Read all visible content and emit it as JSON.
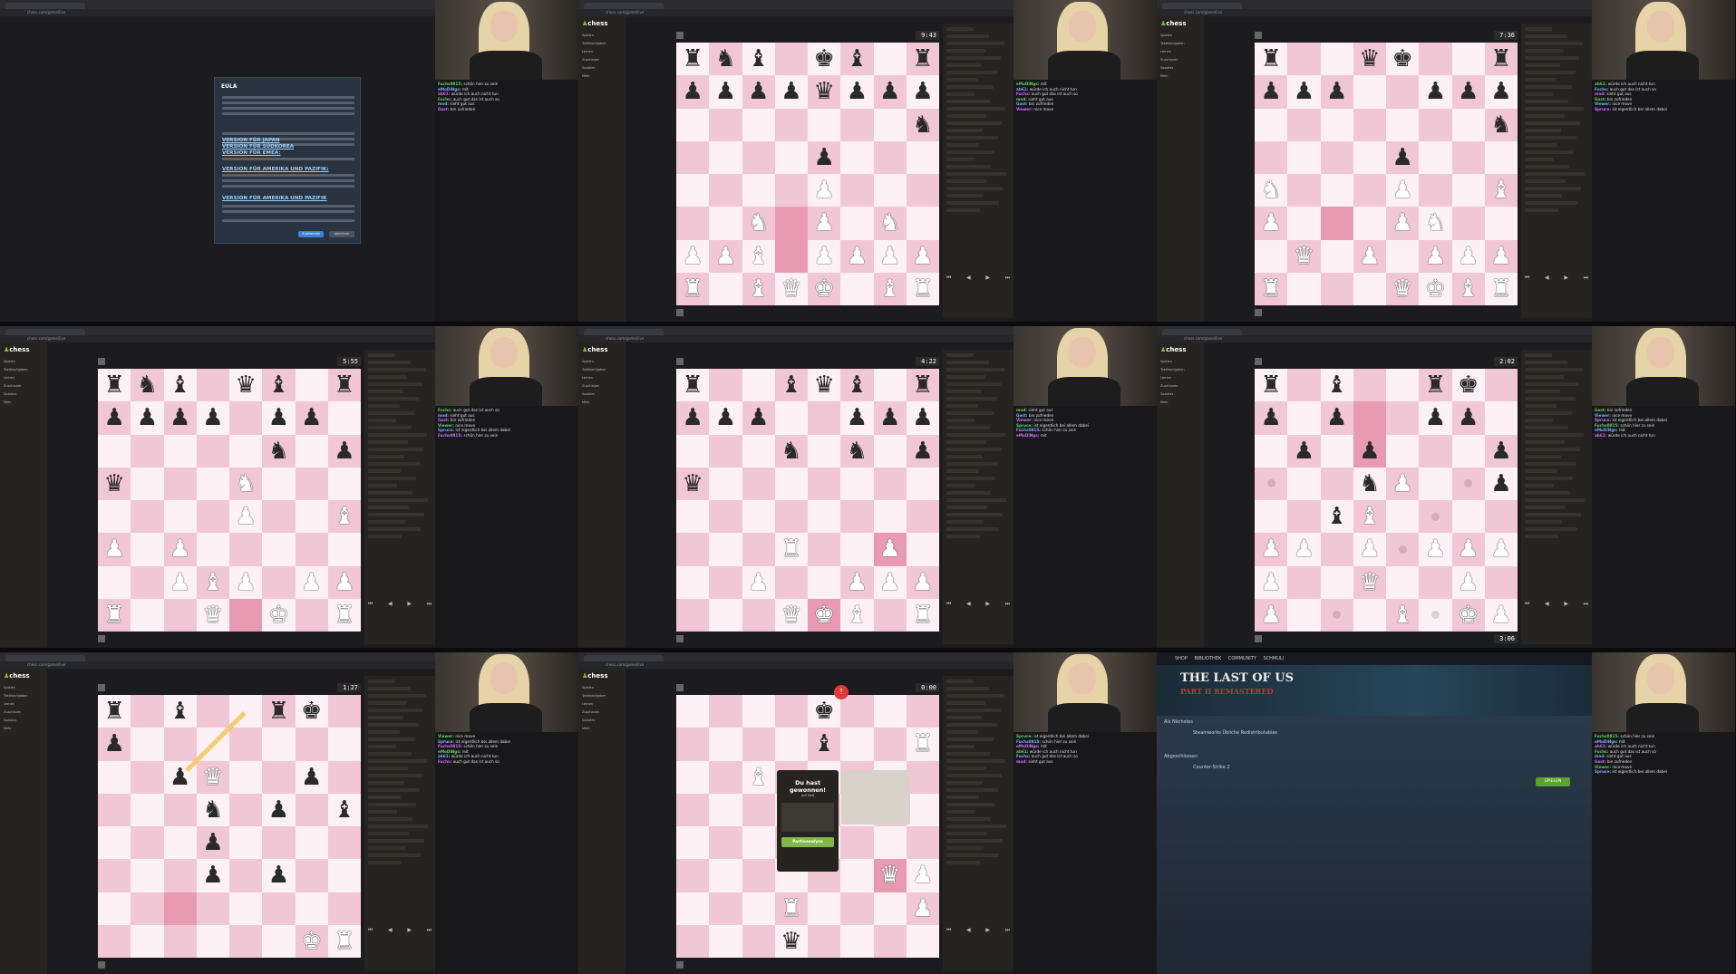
{
  "tiles": [
    {
      "kind": "eula",
      "eula": {
        "title": "EULA",
        "links": [
          "VERSION FÜR JAPAN",
          "VERSION FÜR SÜDKOREA",
          "VERSION FÜR EMEA:",
          "VERSION FÜR AMERIKA UND PAZIFIK:",
          "VERSION FÜR AMERIKA UND PAZIFIK"
        ],
        "accept": "Zustimmen",
        "decline": "Ablehnen"
      }
    },
    {
      "kind": "chess",
      "clock_top": "9:43",
      "clock_bottom": "",
      "board": [
        "rnb.kb.r",
        "ppppqppp",
        ".......n",
        "....p...",
        "....P...",
        "..N.P.N.",
        "PPB.PPPP",
        "R.BQK.BR"
      ],
      "hl": [
        [
          5,
          3
        ],
        [
          6,
          3
        ]
      ]
    },
    {
      "kind": "chess",
      "clock_top": "7:36",
      "clock_bottom": "",
      "board": [
        "r..qk..r",
        "ppp..ppp",
        ".......n",
        "....p...",
        "N...P..B",
        "P...PN..",
        ".Q.P.PPP",
        "R...QKBR"
      ],
      "hl": [
        [
          5,
          2
        ]
      ]
    },
    {
      "kind": "chess",
      "clock_top": "5:55",
      "clock_bottom": "",
      "board": [
        "rnb.qb.r",
        "pppp.pp.",
        ".....n.p",
        "q...N...",
        "....P..B",
        "P.P.....",
        "..PBP.PP",
        "R..Q.K.R"
      ],
      "hl": [
        [
          7,
          4
        ]
      ]
    },
    {
      "kind": "chess",
      "clock_top": "4:22",
      "clock_bottom": "",
      "board": [
        "r..bqb.r",
        "ppp..ppp",
        "...n.n.p",
        "q.......",
        "........",
        "...R..P.",
        "..P..PPP",
        "...QKB.R"
      ],
      "hl": [
        [
          5,
          6
        ],
        [
          7,
          4
        ]
      ]
    },
    {
      "kind": "chess",
      "clock_top": "2:02",
      "clock_bottom": "3:06",
      "board": [
        "r.b..rk.",
        "p.p..pp.",
        ".p.p...p",
        "...nP..p",
        "..bB....",
        "PP.P.PPP",
        "P..Q..P.",
        "P...B.KP"
      ],
      "hl": [
        [
          1,
          3
        ],
        [
          2,
          3
        ]
      ]
    },
    {
      "kind": "chess",
      "clock_top": "1:27",
      "clock_bottom": "",
      "board": [
        "r.b..rk.",
        "p.......",
        "..pQ..p.",
        "...n.p.b",
        "...p....",
        "...p.p..",
        "........",
        "......KR"
      ],
      "hl": [
        [
          6,
          2
        ]
      ]
    },
    {
      "kind": "chess",
      "clock_top": "0:00",
      "clock_bottom": "",
      "board": [
        "....k...",
        "....b..R",
        "..B.....",
        "........",
        "........",
        "......QP",
        "...R...P",
        "...q...."
      ],
      "hl": [
        [
          5,
          6
        ]
      ],
      "win": {
        "title": "Du hast gewonnen!",
        "sub": "auf Zeit",
        "btn": "Partieanalyse"
      }
    },
    {
      "kind": "steam",
      "nav": "SHOP BIBLIOTHEK COMMUNITY SCHMULI",
      "game_title": "THE LAST OF US",
      "game_sub": "PART II REMASTERED",
      "section1": "Als Nächstes",
      "item1": "Steamworks Übliche Redistributables",
      "section2": "Abgeschlossen",
      "item2": "Counter-Strike 2",
      "play": "SPIELEN"
    }
  ],
  "url": "chess.com/game/live",
  "sidebar": [
    "Spielen",
    "Taktikaufgaben",
    "Lernen",
    "Zuschauen",
    "Soziales",
    "Mehr"
  ],
  "chat": [
    [
      "Fuchs0815",
      "schön hier zu sein"
    ],
    [
      "eMoDiNgs",
      "mit"
    ],
    [
      "ab61",
      "würde ich auch nicht tun"
    ],
    [
      "Fuchs",
      "auch gut das ist auch so"
    ],
    [
      "mod",
      "sieht gut aus"
    ],
    [
      "Gast",
      "bin zufrieden"
    ],
    [
      "Viewer",
      "nice move"
    ],
    [
      "Spruce",
      "ist eigentlich bei allem dabei"
    ]
  ],
  "colors": {
    "light": "#fdf1f5",
    "dark": "#f2c7d5",
    "highlight": "#e89ab3",
    "accent": "#81b64c"
  }
}
